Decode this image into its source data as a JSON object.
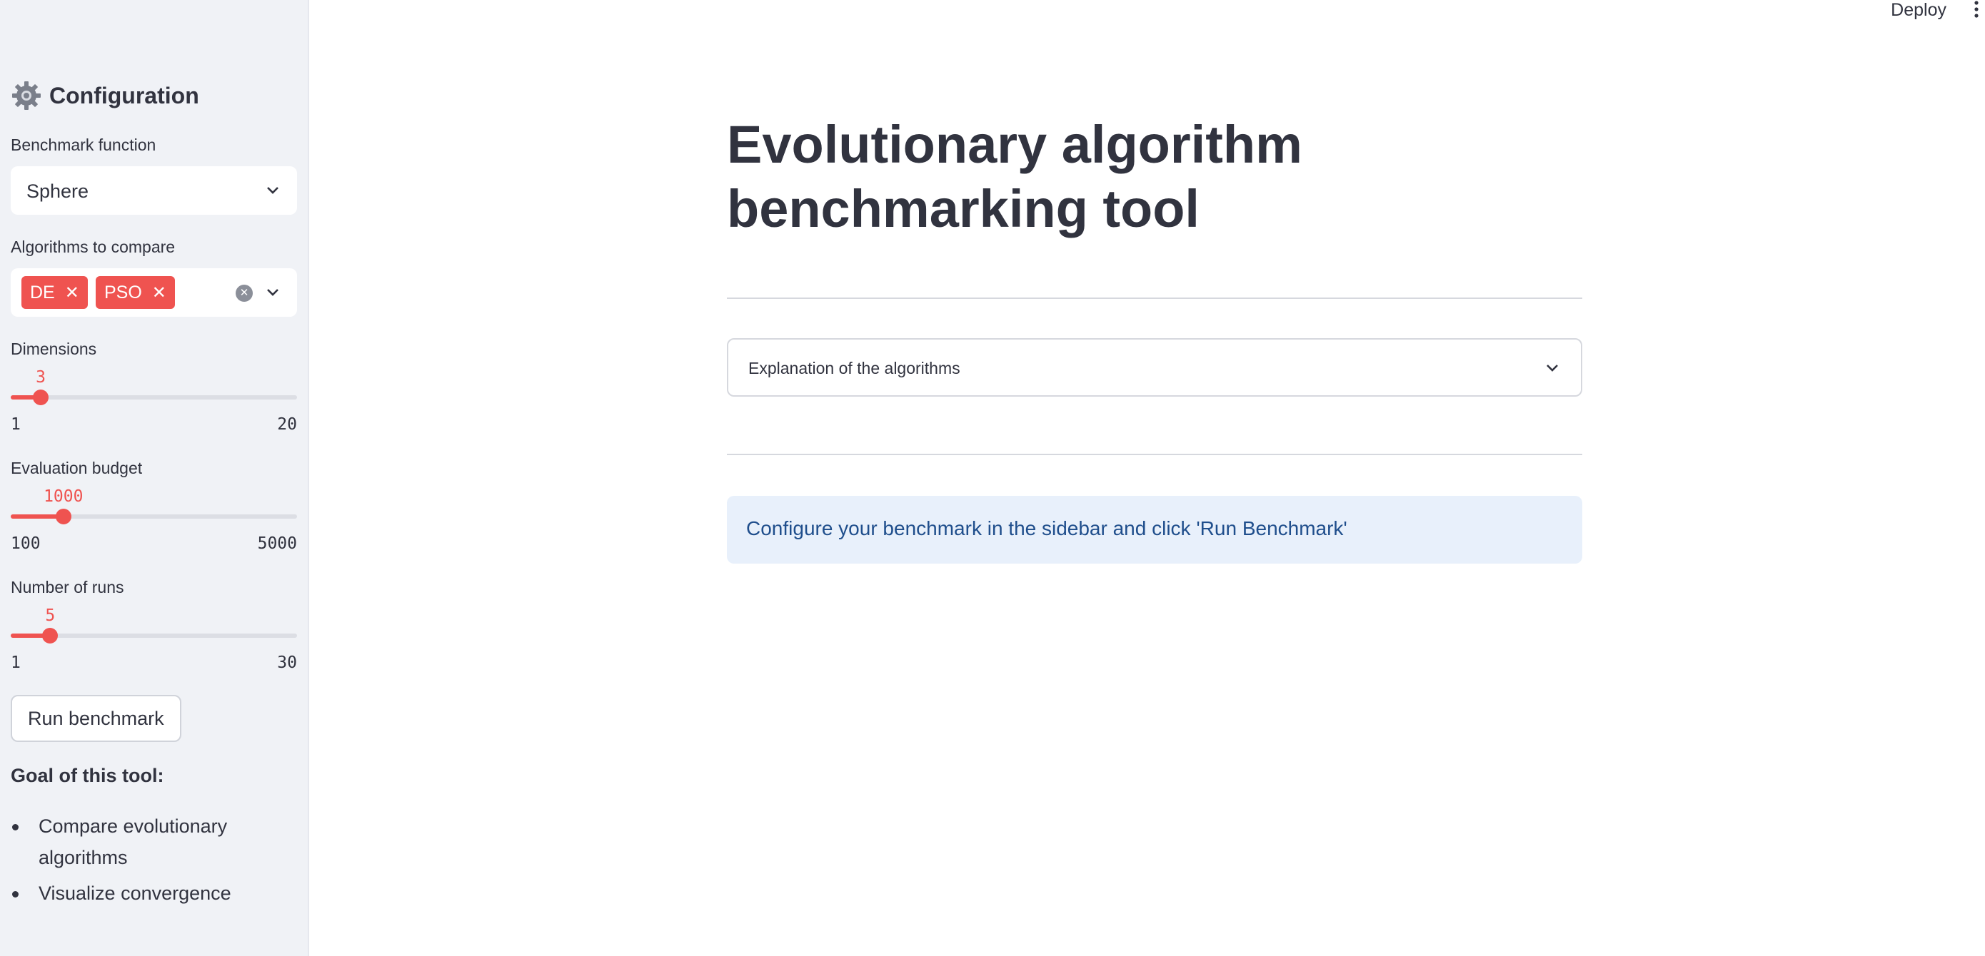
{
  "header": {
    "deploy_label": "Deploy"
  },
  "sidebar": {
    "title": "Configuration",
    "benchmark": {
      "label": "Benchmark function",
      "value": "Sphere"
    },
    "algorithms": {
      "label": "Algorithms to compare",
      "selected": [
        "DE",
        "PSO"
      ]
    },
    "dimensions": {
      "label": "Dimensions",
      "value": "3",
      "min": "1",
      "max": "20",
      "fraction": 0.105
    },
    "budget": {
      "label": "Evaluation budget",
      "value": "1000",
      "min": "100",
      "max": "5000",
      "fraction": 0.184
    },
    "runs": {
      "label": "Number of runs",
      "value": "5",
      "min": "1",
      "max": "30",
      "fraction": 0.138
    },
    "run_button": "Run benchmark",
    "goal_title": "Goal of this tool:",
    "goal_items": [
      "Compare evolutionary algorithms",
      "Visualize convergence"
    ]
  },
  "main": {
    "title": "Evolutionary algorithm benchmarking tool",
    "expander_label": "Explanation of the algorithms",
    "info_text": "Configure your benchmark in the sidebar and click 'Run Benchmark'"
  },
  "colors": {
    "accent": "#ef5350",
    "sidebar_bg": "#f0f2f6",
    "info_bg": "#e8f0fb",
    "info_text": "#1f4e8c"
  },
  "icons": [
    "gear-icon",
    "chevron-down-icon",
    "close-icon",
    "clear-icon",
    "kebab-menu-icon"
  ]
}
